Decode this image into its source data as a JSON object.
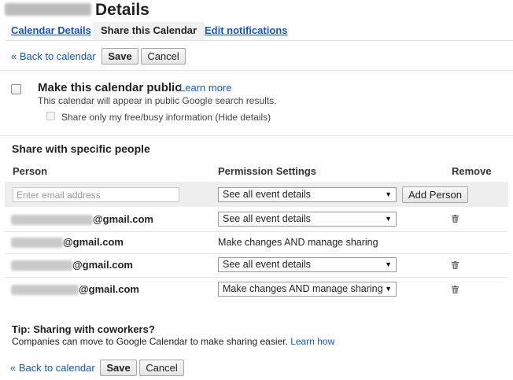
{
  "header": {
    "title": "Details"
  },
  "tabs": [
    {
      "label": "Calendar Details"
    },
    {
      "label": "Share this Calendar"
    },
    {
      "label": "Edit notifications"
    }
  ],
  "toolbar": {
    "back_label": "« Back to calendar",
    "save_label": "Save",
    "cancel_label": "Cancel"
  },
  "public": {
    "title": "Make this calendar public",
    "learn_more": "Learn more",
    "description": "This calendar will appear in public Google search results.",
    "freebusy_label": "Share only my free/busy information (Hide details)",
    "public_checked": false,
    "freebusy_checked": false
  },
  "sharing": {
    "section_title": "Share with specific people",
    "columns": {
      "person": "Person",
      "permission": "Permission Settings",
      "remove": "Remove"
    },
    "email_placeholder": "Enter email address",
    "new_permission": "See all event details",
    "add_person_label": "Add Person",
    "rows": [
      {
        "email_suffix": "@gmail.com",
        "permission": "See all event details",
        "editable": true
      },
      {
        "email_suffix": "@gmail.com",
        "permission": "Make changes AND manage sharing",
        "editable": false
      },
      {
        "email_suffix": "@gmail.com",
        "permission": "See all event details",
        "editable": true
      },
      {
        "email_suffix": "@gmail.com",
        "permission": "Make changes AND manage sharing",
        "editable": true
      }
    ]
  },
  "tip": {
    "title": "Tip: Sharing with coworkers?",
    "body": "Companies can move to Google Calendar to make sharing easier.",
    "learn_how": "Learn how"
  },
  "bottom": {
    "back_label": "« Back to calendar",
    "save_label": "Save",
    "cancel_label": "Cancel"
  },
  "icons": {
    "dropdown": "dropdown-arrow-icon",
    "remove": "trash-icon"
  }
}
